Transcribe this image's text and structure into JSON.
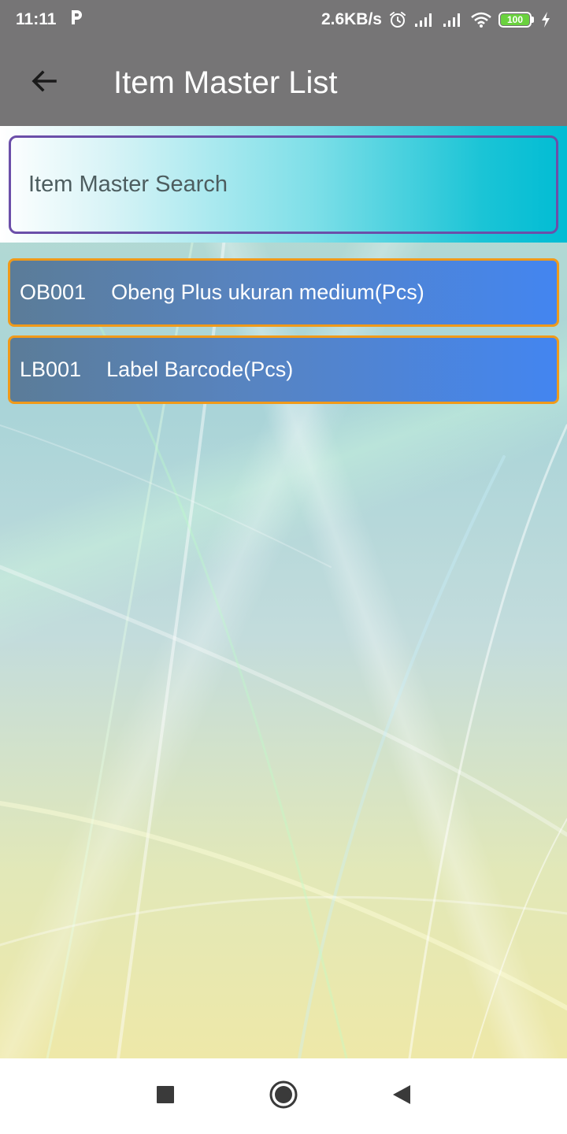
{
  "status_bar": {
    "time": "11:11",
    "app_icon": "parking-p-icon",
    "network_speed": "2.6KB/s",
    "battery_level": "100",
    "icons": [
      "alarm-icon",
      "signal-icon",
      "signal-icon",
      "wifi-icon",
      "battery-icon",
      "charging-bolt-icon"
    ]
  },
  "app_bar": {
    "title": "Item Master List",
    "back_icon": "arrow-back-icon"
  },
  "search": {
    "placeholder": "Item Master Search"
  },
  "items": [
    {
      "code": "OB001",
      "name": "Obeng Plus ukuran medium(Pcs)"
    },
    {
      "code": "LB001",
      "name": "Label Barcode(Pcs)"
    }
  ],
  "nav_bar": {
    "icons": [
      "recent-apps-square-icon",
      "home-circle-icon",
      "back-triangle-icon"
    ]
  },
  "colors": {
    "app_bar": "#767576",
    "search_border": "#6b4fa9",
    "item_border": "#f09a1a",
    "item_bg_start": "#5b7c98",
    "item_bg_end": "#4385f0",
    "search_band_end": "#00bcd4"
  }
}
